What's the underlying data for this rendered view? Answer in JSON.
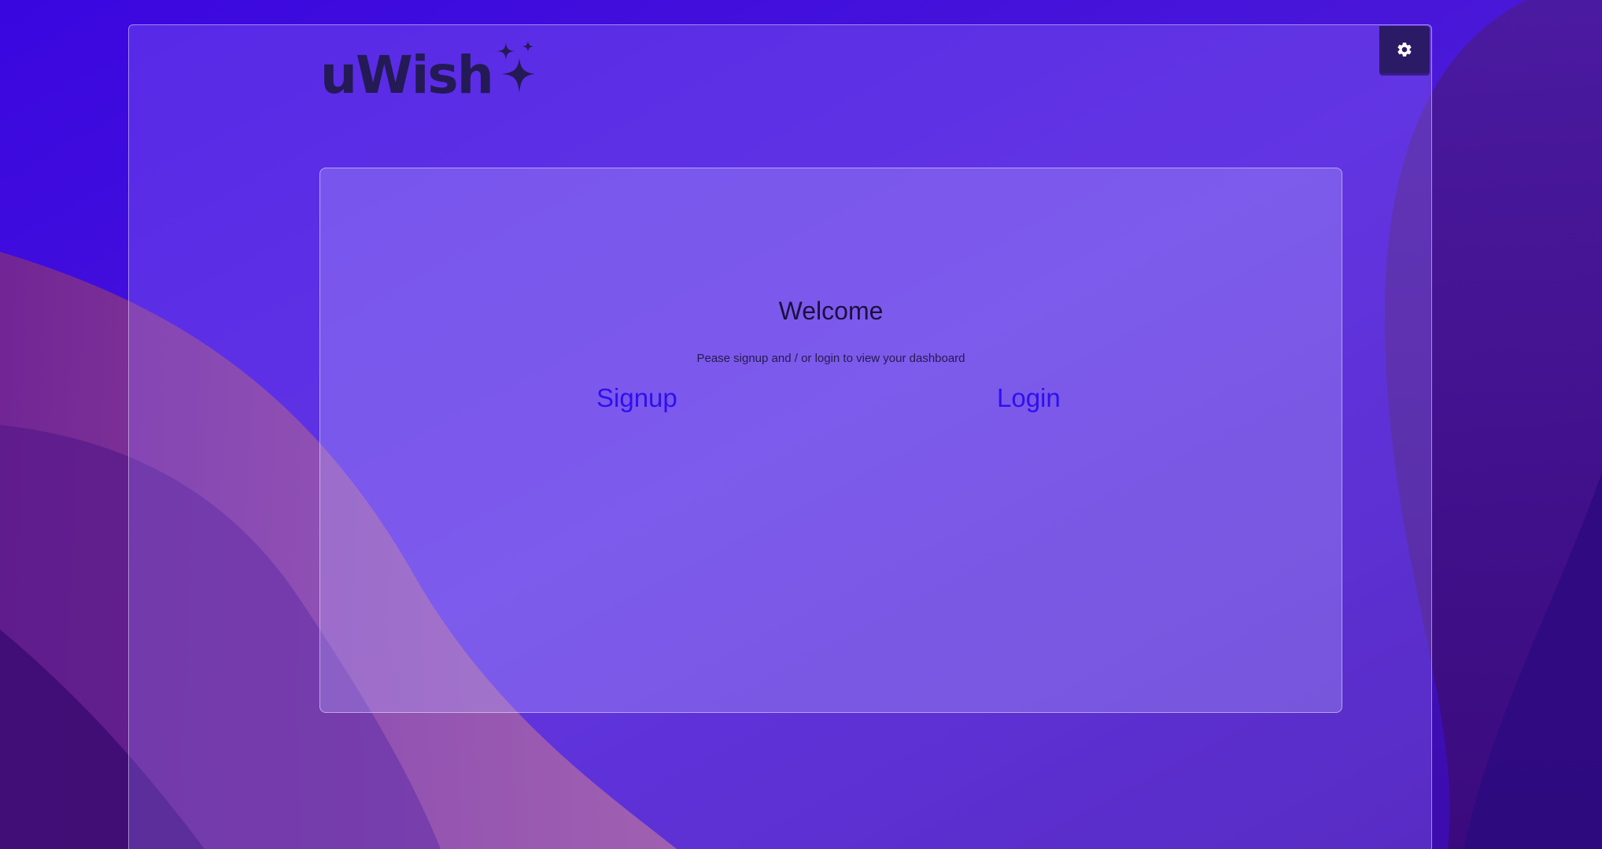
{
  "brand": {
    "name": "uWish",
    "icon": "sparkles-icon"
  },
  "header": {
    "settings_icon": "gear-icon"
  },
  "main": {
    "title": "Welcome",
    "subtitle": "Pease signup and / or login to view your dashboard",
    "signup_label": "Signup",
    "login_label": "Login"
  },
  "colors": {
    "background": "#3300d6",
    "link": "#2e10ef",
    "logo": "#241a55",
    "settings_button": "#2b1a66"
  }
}
